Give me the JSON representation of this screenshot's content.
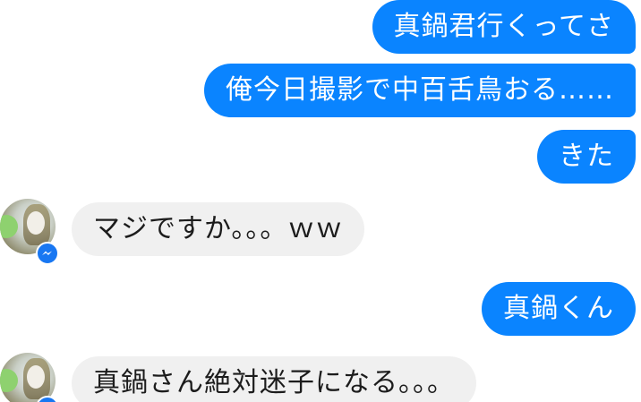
{
  "messages": [
    {
      "id": "m1",
      "direction": "outgoing",
      "text": "真鍋君行くってさ"
    },
    {
      "id": "m2",
      "direction": "outgoing",
      "text": "俺今日撮影で中百舌鳥おる……"
    },
    {
      "id": "m3",
      "direction": "outgoing",
      "text": "きた"
    },
    {
      "id": "m4",
      "direction": "incoming",
      "text": "マジですか。。。ｗｗ"
    },
    {
      "id": "m5",
      "direction": "outgoing",
      "text": "真鍋くん"
    },
    {
      "id": "m6",
      "direction": "incoming",
      "text": "真鍋さん絶対迷子になる。。。"
    }
  ],
  "colors": {
    "outgoing_bubble": "#0a84ff",
    "incoming_bubble": "#f0f0f0",
    "messenger_badge": "#1877f2"
  },
  "icons": {
    "avatar": "contact-avatar",
    "badge": "messenger-icon"
  }
}
